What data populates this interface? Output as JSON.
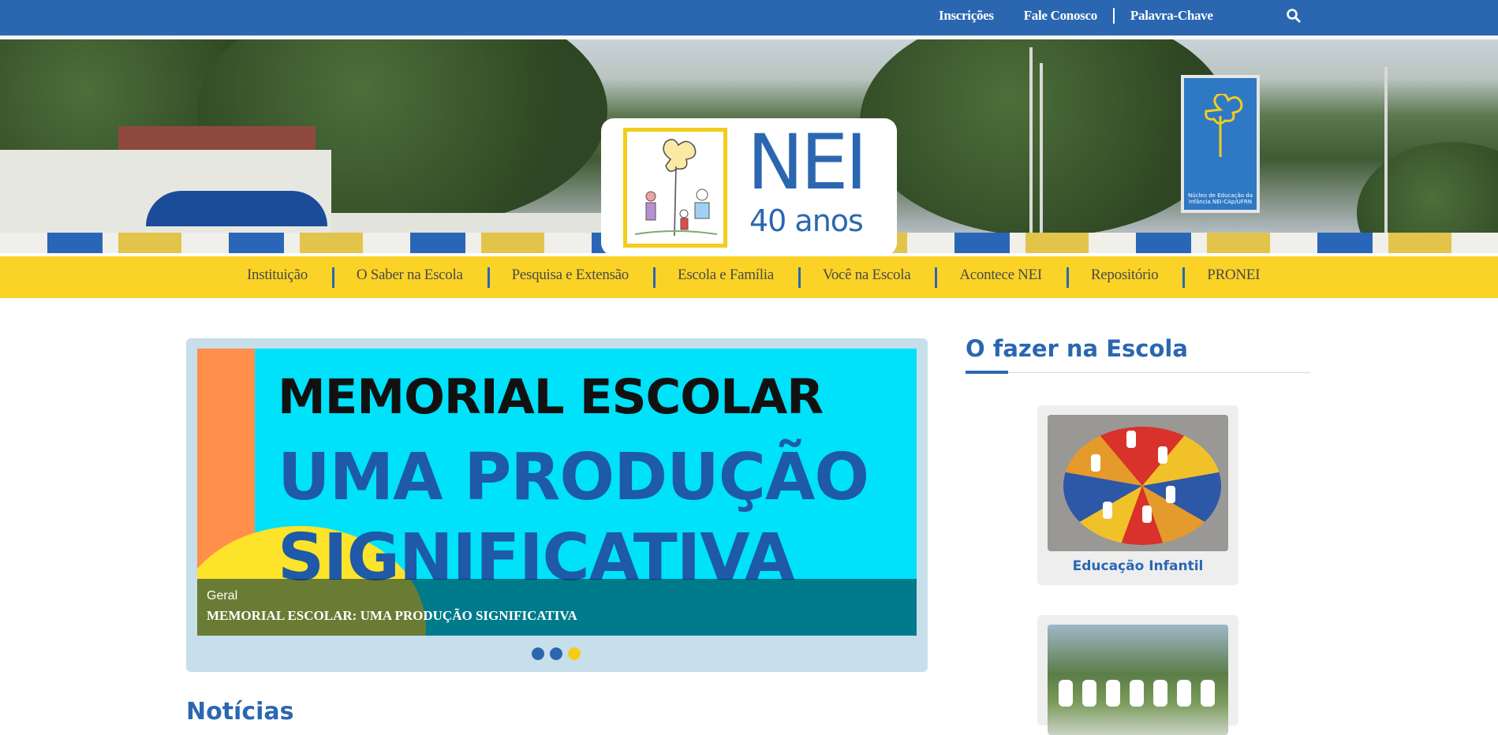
{
  "topbar": {
    "links": [
      "Inscrições",
      "Fale Conosco",
      "Palavra-Chave"
    ],
    "search_icon": "search-icon"
  },
  "hero": {
    "logo": {
      "title": "NEI",
      "subtitle": "40 anos"
    },
    "sign_text": "Núcleo de Educação da Infância NEI-CAp/UFRN"
  },
  "nav": {
    "items": [
      "Instituição",
      "O Saber na Escola",
      "Pesquisa e Extensão",
      "Escola e Família",
      "Você na Escola",
      "Acontece NEI",
      "Repositório",
      "PRONEI"
    ]
  },
  "slider": {
    "slide": {
      "line1": "MEMORIAL ESCOLAR",
      "line2": "UMA PRODUÇÃO",
      "line3": "SIGNIFICATIVA",
      "category": "Geral",
      "caption": "MEMORIAL ESCOLAR: UMA PRODUÇÃO SIGNIFICATIVA"
    },
    "dot_count": 3,
    "active_dot": 3
  },
  "main": {
    "news_heading": "Notícias"
  },
  "sidebar": {
    "title": "O fazer na Escola",
    "cards": [
      {
        "label": "Educação Infantil"
      },
      {
        "label": ""
      }
    ]
  },
  "colors": {
    "primary_blue": "#2b67b1",
    "nav_yellow": "#fbd327",
    "slide_cyan": "#00e1fa",
    "slide_orange": "#ff8f4b"
  }
}
